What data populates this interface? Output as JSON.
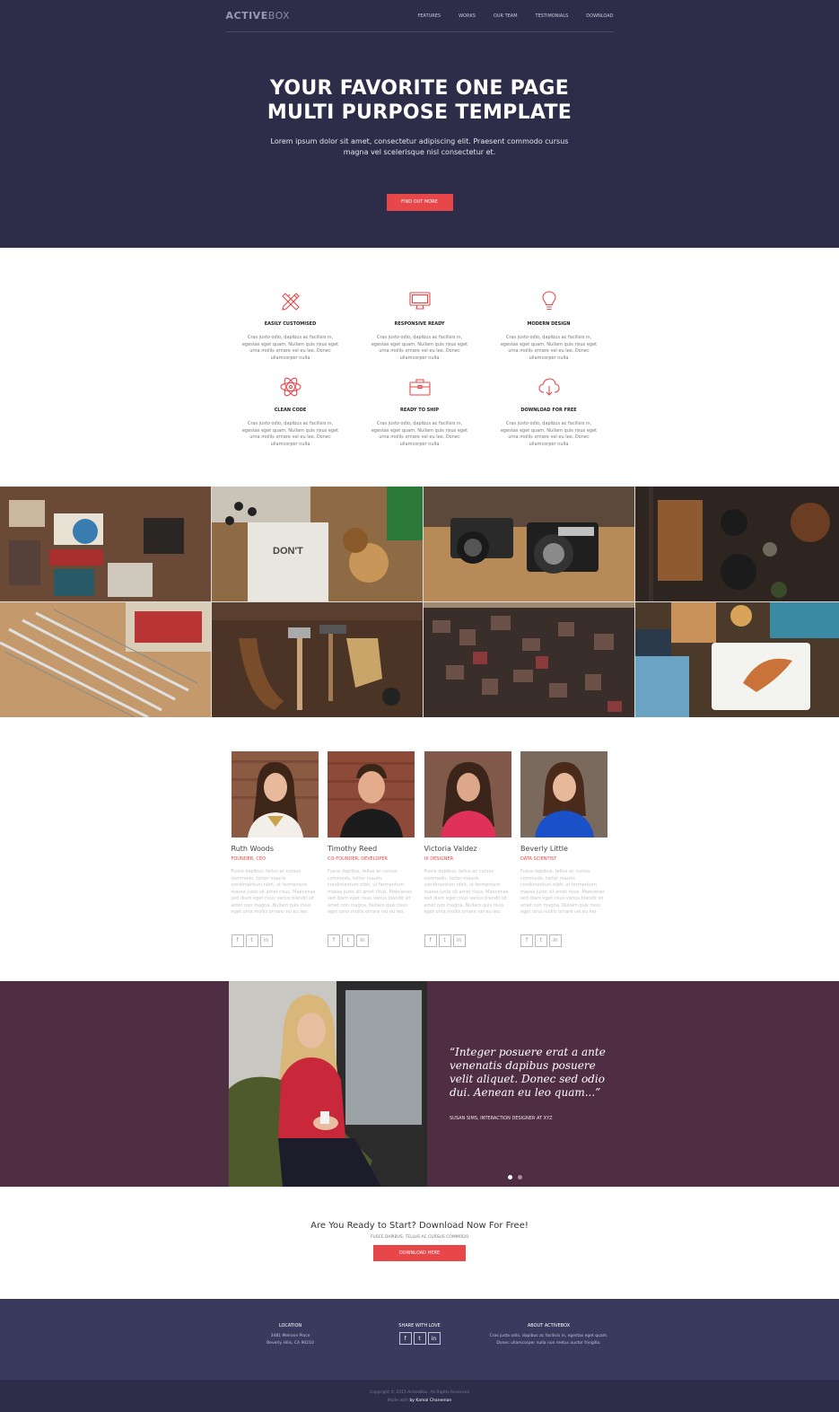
{
  "colors": {
    "hero_bg": "#2d2d4a",
    "accent": "#e8474a",
    "testimonial_bg": "#4f2e43",
    "footer_bg": "#393a5e"
  },
  "nav": {
    "logo_part1": "ACTIVE",
    "logo_part2": "BOX",
    "items": [
      "FEATURES",
      "WORKS",
      "OUR TEAM",
      "TESTIMONIALS",
      "DOWNLOAD"
    ]
  },
  "hero": {
    "title_line1": "YOUR FAVORITE ONE PAGE",
    "title_line2": "MULTI PURPOSE TEMPLATE",
    "text": "Lorem ipsum dolor sit amet, consectetur adipiscing elit. Praesent commodo cursus magna vel scelerisque nisl consectetur et.",
    "button": "FIND OUT MORE"
  },
  "features": [
    {
      "icon": "pencil-ruler-icon",
      "title": "EASILY CUSTOMISED",
      "text": "Cras justo odio, dapibus ac facilisis in, egestas eget quam. Nullam quis risus eget urna mollis ornare vel eu leo. Donec ullamcorper nulla"
    },
    {
      "icon": "monitor-icon",
      "title": "RESPONSIVE READY",
      "text": "Cras justo odio, dapibus ac facilisis in, egestas eget quam. Nullam quis risus eget urna mollis ornare vel eu leo. Donec ullamcorper nulla"
    },
    {
      "icon": "lightbulb-icon",
      "title": "MODERN DESIGN",
      "text": "Cras justo odio, dapibus ac facilisis in, egestas eget quam. Nullam quis risus eget urna mollis ornare vel eu leo. Donec ullamcorper nulla"
    },
    {
      "icon": "atom-icon",
      "title": "CLEAN CODE",
      "text": "Cras justo odio, dapibus ac facilisis in, egestas eget quam. Nullam quis risus eget urna mollis ornare vel eu leo. Donec ullamcorper nulla"
    },
    {
      "icon": "toolbox-icon",
      "title": "READY TO SHIP",
      "text": "Cras justo odio, dapibus ac facilisis in, egestas eget quam. Nullam quis risus eget urna mollis ornare vel eu leo. Donec ullamcorper nulla"
    },
    {
      "icon": "cloud-download-icon",
      "title": "DOWNLOAD FOR FREE",
      "text": "Cras justo odio, dapibus ac facilisis in, egestas eget quam. Nullam quis risus eget urna mollis ornare vel eu leo. Donec ullamcorper nulla"
    }
  ],
  "team": [
    {
      "name": "Ruth Woods",
      "role": "FOUNDER, CEO",
      "bio": "Fusce dapibus, tellus ac cursus commodo, tortor mauris condimentum nibh, ut fermentum massa justo sit amet risus. Maecenas sed diam eget risus varius blandit sit amet non magna. Nullam quis risus eget urna mollis ornare vel eu leo."
    },
    {
      "name": "Timothy Reed",
      "role": "CO-FOUNDER, DEVELOPER",
      "bio": "Fusce dapibus, tellus ac cursus commodo, tortor mauris condimentum nibh, ut fermentum massa justo sit amet risus. Maecenas sed diam eget risus varius blandit sit amet non magna. Nullam quis risus eget urna mollis ornare vel eu leo."
    },
    {
      "name": "Victoria Valdez",
      "role": "UI DESIGNER",
      "bio": "Fusce dapibus, tellus ac cursus commodo, tortor mauris condimentum nibh, ut fermentum massa justo sit amet risus. Maecenas sed diam eget risus varius blandit sit amet non magna. Nullam quis risus eget urna mollis ornare vel eu leo."
    },
    {
      "name": "Beverly Little",
      "role": "DATA SCIENTIST",
      "bio": "Fusce dapibus, tellus ac cursus commodo, tortor mauris condimentum nibh, ut fermentum massa justo sit amet risus. Maecenas sed diam eget risus varius blandit sit amet non magna. Nullam quis risus eget urna mollis ornare vel eu leo."
    }
  ],
  "social_icons": [
    "f",
    "t",
    "in"
  ],
  "testimonial": {
    "quote": "“Integer posuere erat a ante venenatis dapibus posuere velit aliquet. Donec sed odio dui. Aenean eu leo quam...”",
    "author": "SUSAN SIMS, INTERACTION DESIGNER AT XYZ"
  },
  "cta": {
    "title": "Are You Ready to Start? Download Now For Free!",
    "subtitle": "FUSCE DAPIBUS, TELLUS AC CURSUS COMMODO",
    "button": "DOWNLOAD HERE"
  },
  "footer": {
    "location_title": "LOCATION",
    "location_line1": "3481 Melrose Place",
    "location_line2": "Beverly Hills, CA 90210",
    "share_title": "SHARE WITH LOVE",
    "about_title": "ABOUT ACTIVEBOX",
    "about_text": "Cras justo odio, dapibus ac facilisis in, egestas eget quam. Donec ullamcorper nulla non metus auctor fringilla.",
    "copyright": "Copyright © 2015 ActiveBox. All Rights Reserved",
    "made_with": "Made with",
    "made_by": "by Kamal Chaneman"
  }
}
